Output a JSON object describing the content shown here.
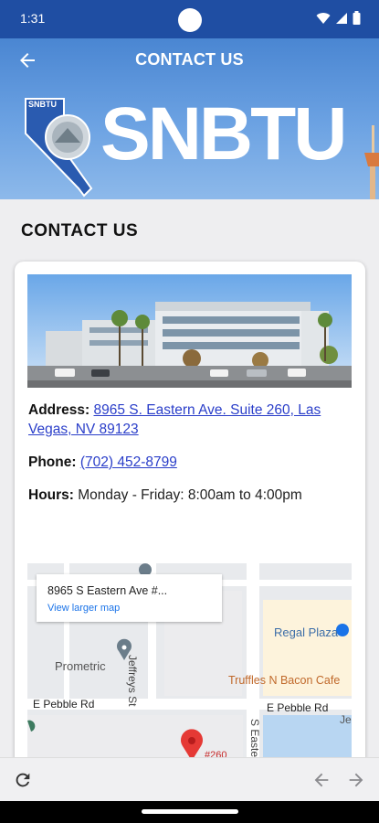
{
  "status_bar": {
    "time": "1:31"
  },
  "header": {
    "title": "CONTACT US",
    "logo_text": "SNBTU",
    "badge_text": "SNBTU"
  },
  "page": {
    "heading": "CONTACT US"
  },
  "contact": {
    "address_label": "Address:",
    "address_value": "8965 S. Eastern Ave. Suite 260, Las Vegas, NV 89123",
    "phone_label": "Phone:",
    "phone_value": "(702) 452-8799",
    "hours_label": "Hours:",
    "hours_days": "Monday - Friday:",
    "hours_time": "8:00am to 4:00pm"
  },
  "map": {
    "popup_address": "8965 S Eastern Ave #...",
    "popup_link": "View larger map",
    "labels": {
      "regal_plaza": "Regal Plaza",
      "prometric": "Prometric",
      "jeffreys_st": "Jeffreys St",
      "truffles": "Truffles N Bacon Cafe",
      "pebble_left": "E Pebble Rd",
      "pebble_right": "E Pebble Rd",
      "s_eastern": "S Easte",
      "je": "Je",
      "marker": "#260"
    }
  },
  "colors": {
    "status_bar": "#1f4ea3",
    "link": "#2a3ec9",
    "map_link": "#1a73e8",
    "marker": "#e53935"
  }
}
